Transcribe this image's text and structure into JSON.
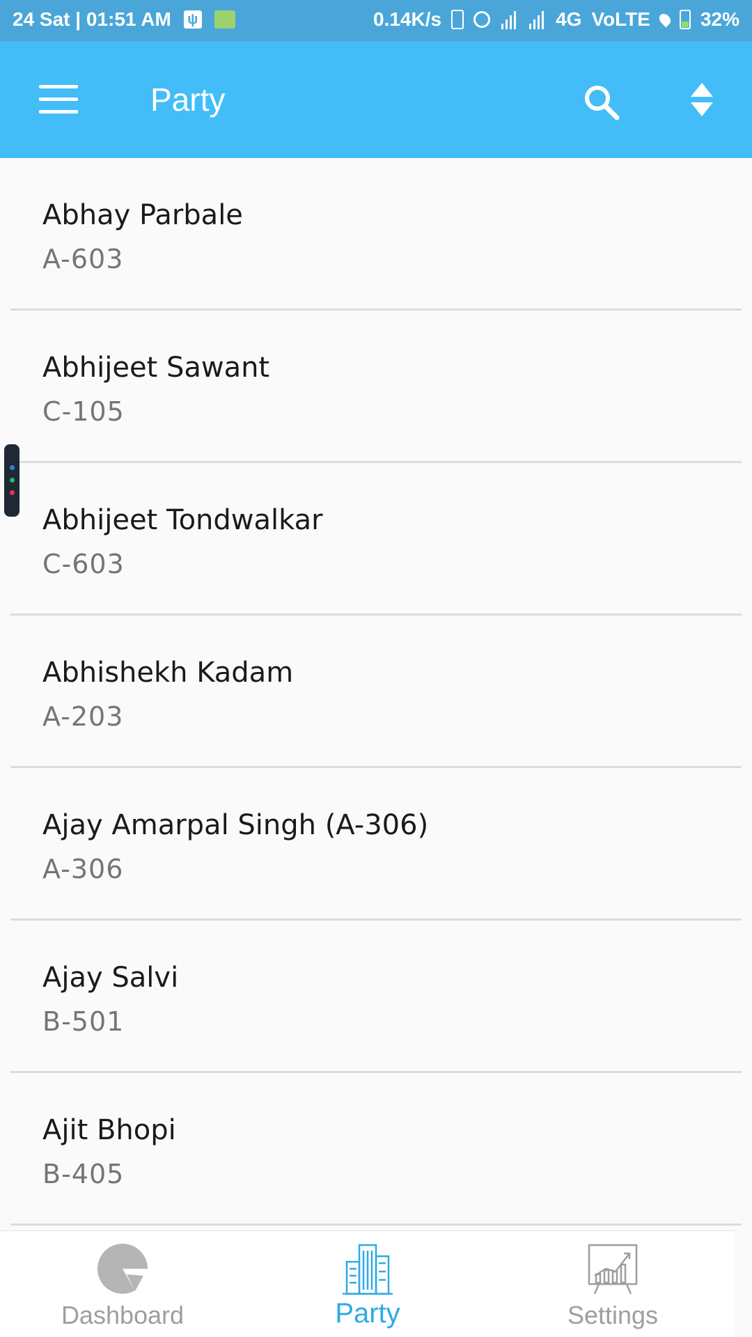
{
  "status_bar": {
    "left_text": "24 Sat | 01:51 AM",
    "speed": "0.14K/s",
    "network": "4G",
    "volte": "VoLTE",
    "battery": "32%"
  },
  "app_bar": {
    "title": "Party",
    "menu_icon": "hamburger-menu-icon",
    "search_icon": "search-icon",
    "sort_icon": "sort-icon"
  },
  "parties": [
    {
      "name": "Abhay Parbale",
      "code": "A-603"
    },
    {
      "name": "Abhijeet Sawant",
      "code": "C-105"
    },
    {
      "name": "Abhijeet Tondwalkar",
      "code": "C-603"
    },
    {
      "name": "Abhishekh Kadam",
      "code": "A-203"
    },
    {
      "name": "Ajay Amarpal Singh (A-306)",
      "code": "A-306"
    },
    {
      "name": "Ajay Salvi",
      "code": "B-501"
    },
    {
      "name": "Ajit Bhopi",
      "code": "B-405"
    }
  ],
  "bottom_nav": {
    "items": [
      {
        "label": "Dashboard",
        "icon": "pie-chart-icon",
        "active": false
      },
      {
        "label": "Party",
        "icon": "buildings-icon",
        "active": true
      },
      {
        "label": "Settings",
        "icon": "growth-chart-icon",
        "active": false
      }
    ]
  },
  "colors": {
    "status_bar": "#4aa6d9",
    "app_bar": "#43bdf8",
    "active_nav": "#2ea9e6",
    "inactive_nav": "#9e9e9e",
    "background": "#fafafa"
  }
}
